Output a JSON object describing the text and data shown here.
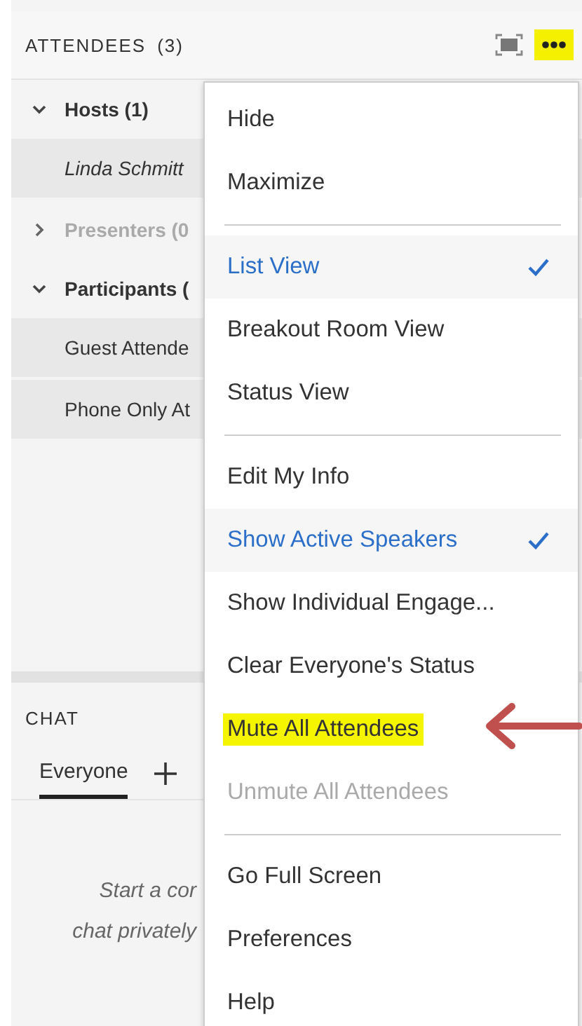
{
  "attendees": {
    "title": "ATTENDEES",
    "count": "(3)",
    "more_button_highlighted": true,
    "groups": [
      {
        "label": "Hosts (1)",
        "expanded": true,
        "disabled": false,
        "members": [
          {
            "name": "Linda Schmitt",
            "italic": true
          }
        ]
      },
      {
        "label": "Presenters (0",
        "expanded": false,
        "disabled": true
      },
      {
        "label": "Participants (",
        "expanded": true,
        "disabled": false,
        "members": [
          {
            "name": "Guest Attende",
            "italic": false
          },
          {
            "name": "Phone Only At",
            "italic": false
          }
        ]
      }
    ]
  },
  "chat": {
    "title": "CHAT",
    "tabs": [
      {
        "label": "Everyone",
        "selected": true
      }
    ],
    "empty_message_lines": [
      "Start a cor",
      "chat privately"
    ]
  },
  "menu": {
    "sections": [
      [
        {
          "label": "Hide",
          "checked": false,
          "disabled": false,
          "highlighted": false
        },
        {
          "label": "Maximize",
          "checked": false,
          "disabled": false,
          "highlighted": false
        }
      ],
      [
        {
          "label": "List View",
          "checked": true,
          "disabled": false,
          "highlighted": false
        },
        {
          "label": "Breakout Room View",
          "checked": false,
          "disabled": false,
          "highlighted": false
        },
        {
          "label": "Status View",
          "checked": false,
          "disabled": false,
          "highlighted": false
        }
      ],
      [
        {
          "label": "Edit My Info",
          "checked": false,
          "disabled": false,
          "highlighted": false
        },
        {
          "label": "Show Active Speakers",
          "checked": true,
          "disabled": false,
          "highlighted": false
        },
        {
          "label": "Show Individual Engage...",
          "checked": false,
          "disabled": false,
          "highlighted": false
        },
        {
          "label": "Clear Everyone's Status",
          "checked": false,
          "disabled": false,
          "highlighted": false
        },
        {
          "label": "Mute All Attendees",
          "checked": false,
          "disabled": false,
          "highlighted": true
        },
        {
          "label": "Unmute All Attendees",
          "checked": false,
          "disabled": true,
          "highlighted": false
        }
      ],
      [
        {
          "label": "Go Full Screen",
          "checked": false,
          "disabled": false,
          "highlighted": false
        },
        {
          "label": "Preferences",
          "checked": false,
          "disabled": false,
          "highlighted": false
        },
        {
          "label": "Help",
          "checked": false,
          "disabled": false,
          "highlighted": false
        }
      ]
    ]
  }
}
